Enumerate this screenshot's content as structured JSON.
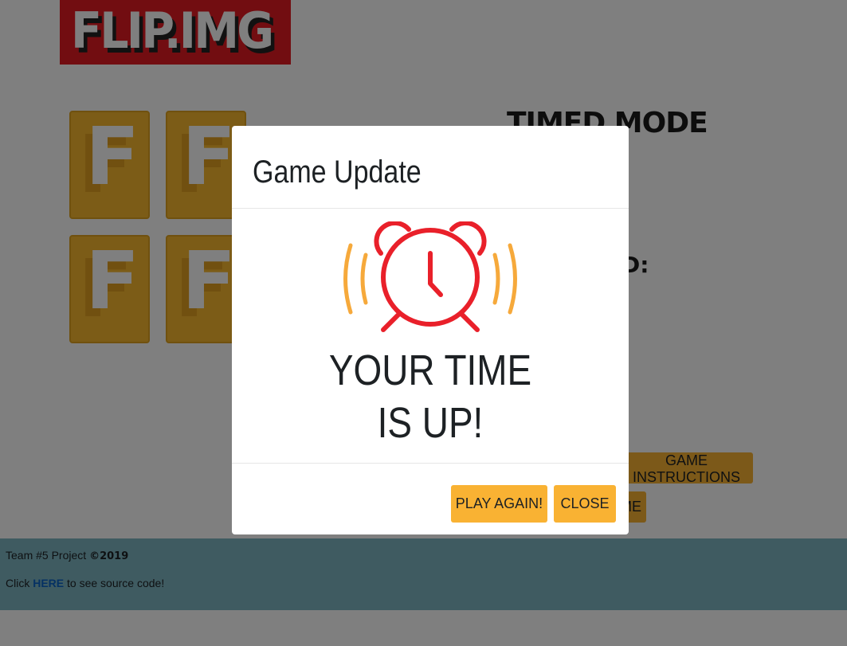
{
  "logo": {
    "text": "FLIP.IMG"
  },
  "cards": [
    {
      "letter": "F"
    },
    {
      "letter": "F"
    },
    {
      "letter": "F"
    },
    {
      "letter": "F"
    }
  ],
  "sidebar": {
    "mode_title": "TIMED MODE",
    "partial_label": "D:",
    "instructions_button": "GAME INSTRUCTIONS",
    "game_button_partial": "ME"
  },
  "footer": {
    "credit_text": "Team #5 Project ",
    "copyright": "©2019",
    "click_text": "Click ",
    "link_text": "HERE",
    "after_link_text": " to see source code!"
  },
  "modal": {
    "title": "Game Update",
    "icon": "alarm-clock-icon",
    "message_line1": "YOUR TIME",
    "message_line2": "IS UP!",
    "play_again_button": "PLAY AGAIN!",
    "close_button": "CLOSE"
  },
  "colors": {
    "logo_bg": "#e51b23",
    "card_bg": "#f9b92e",
    "button_bg": "#f9b233",
    "footer_bg": "#7fb6c2",
    "clock_red": "#e9202a",
    "ring_orange": "#f6a93b"
  }
}
